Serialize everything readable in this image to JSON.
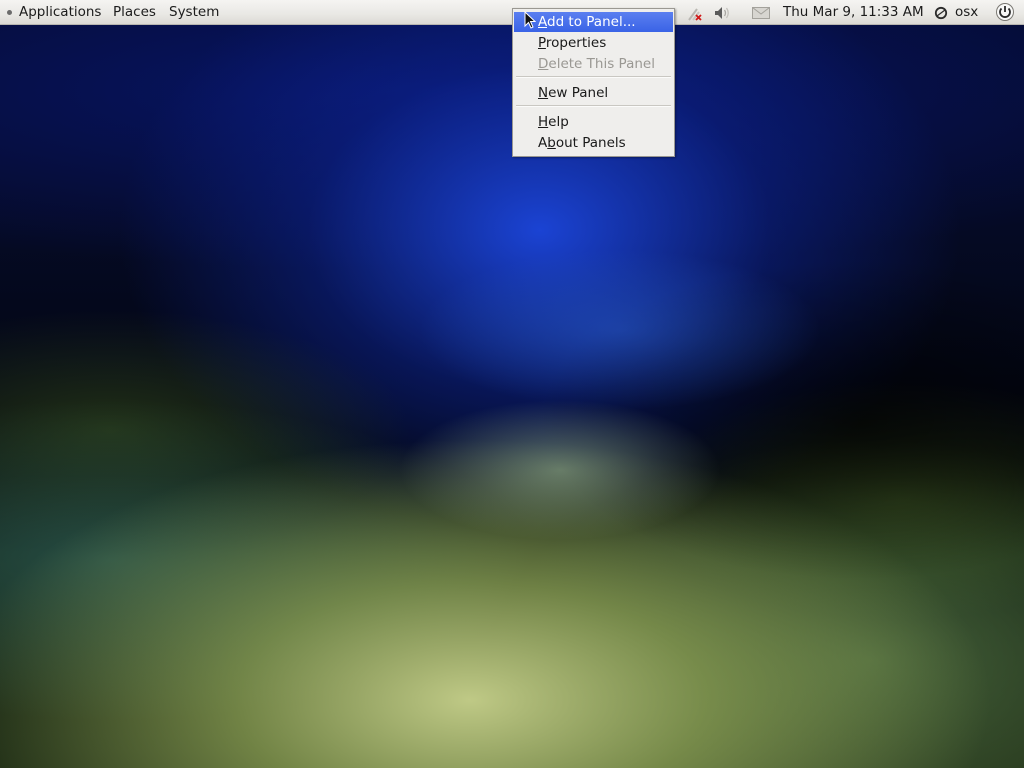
{
  "top_panel": {
    "menus": {
      "applications": "Applications",
      "places": "Places",
      "system": "System"
    },
    "tray": {
      "network_icon": "network-offline-icon",
      "volume_icon": "volume-icon",
      "mail_icon": "mail-icon",
      "clock": "Thu Mar  9, 11:33 AM",
      "user_icon": "user-icon",
      "user": "osx",
      "power_icon": "power-icon"
    }
  },
  "context_menu": {
    "items": [
      {
        "key": "A",
        "rest": "dd to Panel...",
        "state": "highlighted"
      },
      {
        "key": "P",
        "rest": "roperties",
        "state": "normal"
      },
      {
        "key": "D",
        "rest": "elete This Panel",
        "state": "disabled"
      },
      {
        "key": "N",
        "rest": "ew Panel",
        "state": "normal"
      },
      {
        "key": "H",
        "rest": "elp",
        "state": "normal"
      },
      {
        "pre": "A",
        "key": "b",
        "rest": "out Panels",
        "state": "normal"
      }
    ]
  },
  "colors": {
    "highlight": "#3a63e6",
    "panel_bg": "#ebeae7",
    "menu_bg": "#efeeec",
    "disabled_text": "#9a9893"
  }
}
